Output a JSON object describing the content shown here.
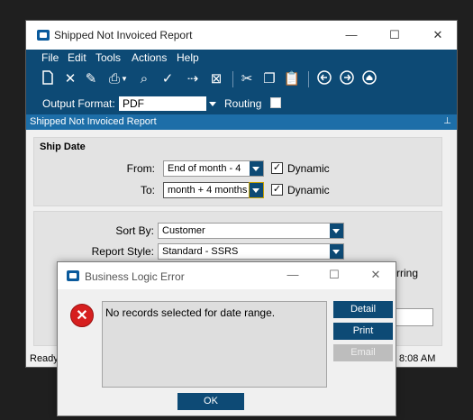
{
  "window": {
    "title": "Shipped Not Invoiced Report",
    "controls": {
      "minimize": "—",
      "maximize": "☐",
      "close": "✕"
    }
  },
  "menu": [
    "File",
    "Edit",
    "Tools",
    "Actions",
    "Help"
  ],
  "toolbar": {
    "icons": [
      "new-icon",
      "delete-icon",
      "clear-icon",
      "print-icon",
      "dropdown-arrow-icon",
      "print-preview-icon",
      "attach-icon",
      "transfer-icon",
      "export-icon",
      "cut-icon",
      "copy-icon",
      "paste-icon",
      "back-icon",
      "forward-icon",
      "home-icon"
    ]
  },
  "output": {
    "format_label": "Output Format:",
    "format_value": "PDF",
    "routing_label": "Routing"
  },
  "panel_title": "Shipped Not Invoiced Report",
  "ship_date": {
    "title": "Ship Date",
    "from_label": "From:",
    "from_value": "End of month - 4",
    "to_label": "To:",
    "to_value": "month + 4 months",
    "dynamic_label": "Dynamic",
    "dynamic_checked": true
  },
  "options": {
    "sort_by_label": "Sort By:",
    "sort_by_value": "Customer",
    "report_style_label": "Report Style:",
    "report_style_value": "Standard - SSRS",
    "partial_text": "rring"
  },
  "status": {
    "left": "Ready",
    "time": "8:08 AM"
  },
  "dialog": {
    "title": "Business Logic Error",
    "message": "No records selected for date range.",
    "buttons": {
      "detail": "Detail",
      "print": "Print",
      "email": "Email",
      "ok": "OK"
    }
  }
}
